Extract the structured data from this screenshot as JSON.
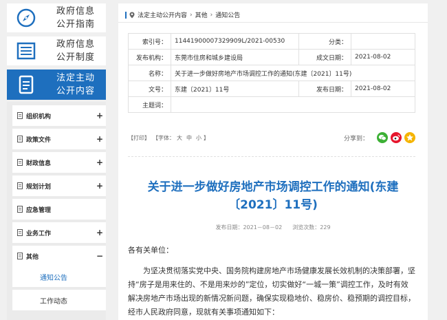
{
  "sidebar": {
    "nav": [
      {
        "line1": "政府信息",
        "line2": "公开指南",
        "icon": "compass-icon"
      },
      {
        "line1": "政府信息",
        "line2": "公开制度",
        "icon": "document-list-icon"
      },
      {
        "line1": "法定主动",
        "line2": "公开内容",
        "icon": "document-icon"
      }
    ],
    "categories": [
      {
        "label": "组织机构",
        "toggle": "+"
      },
      {
        "label": "政策文件",
        "toggle": "+"
      },
      {
        "label": "财政信息",
        "toggle": "+"
      },
      {
        "label": "规划计划",
        "toggle": "+"
      },
      {
        "label": "应急管理",
        "toggle": ""
      },
      {
        "label": "业务工作",
        "toggle": "+"
      },
      {
        "label": "其他",
        "toggle": "−"
      }
    ],
    "subitems": [
      {
        "label": "通知公告"
      },
      {
        "label": "工作动态"
      }
    ]
  },
  "breadcrumb": {
    "items": [
      "法定主动公开内容",
      "其他",
      "通知公告"
    ],
    "separator": "›"
  },
  "meta": {
    "index_label": "索引号：",
    "index_value": "11441900007329909L/2021-00530",
    "category_label": "分类：",
    "category_value": "",
    "publisher_label": "发布机构：",
    "publisher_value": "东莞市住房和城乡建设局",
    "created_label": "成文日期：",
    "created_value": "2021-08-02",
    "name_label": "名称：",
    "name_value": "关于进一步做好房地产市场调控工作的通知(东建〔2021〕11号)",
    "docno_label": "文号：",
    "docno_value": "东建〔2021〕11号",
    "pubdate_label": "发布日期：",
    "pubdate_value": "2021-08-02",
    "keywords_label": "主题词：",
    "keywords_value": ""
  },
  "tools": {
    "print": "【打印】",
    "font_open": "【字体：",
    "font_large": "大",
    "font_medium": "中",
    "font_small": "小",
    "font_close": "】",
    "share_label": "分享到："
  },
  "article": {
    "title": "关于进一步做好房地产市场调控工作的通知(东建〔2021〕11号)",
    "pub_date": "发布日期：2021－08－02",
    "views": "浏览次数：229",
    "salutation": "各有关单位：",
    "paragraph": "为坚决贯彻落实党中央、国务院构建房地产市场健康发展长效机制的决策部署，坚持“房子是用来住的、不是用来炒的”定位，切实做好“一城一策”调控工作，及时有效解决房地产市场出现的新情况新问题，确保实现稳地价、稳房价、稳预期的调控目标，经市人民政府同意，现就有关事项通知如下："
  },
  "colors": {
    "accent": "#1e6fbe",
    "wechat": "#3cb035",
    "weibo": "#e6162d",
    "qzone": "#f5b400"
  }
}
